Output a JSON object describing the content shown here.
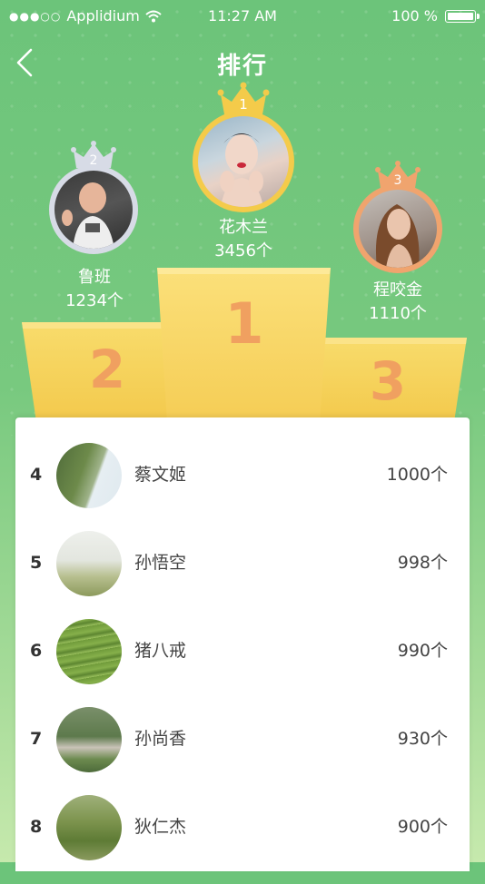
{
  "status_bar": {
    "carrier": "Applidium",
    "time": "11:27 AM",
    "battery": "100 %"
  },
  "header": {
    "title": "排行"
  },
  "podium": [
    {
      "rank": "1",
      "name": "花木兰",
      "score": "3456个"
    },
    {
      "rank": "2",
      "name": "鲁班",
      "score": "1234个"
    },
    {
      "rank": "3",
      "name": "程咬金",
      "score": "1110个"
    }
  ],
  "list": [
    {
      "rank": "4",
      "name": "蔡文姬",
      "score": "1000个"
    },
    {
      "rank": "5",
      "name": "孙悟空",
      "score": "998个"
    },
    {
      "rank": "6",
      "name": "猪八戒",
      "score": "990个"
    },
    {
      "rank": "7",
      "name": "孙尚香",
      "score": "930个"
    },
    {
      "rank": "8",
      "name": "狄仁杰",
      "score": "900个"
    }
  ],
  "colors": {
    "gold": "#f4cb4a",
    "silver": "#d7dbe6",
    "bronze": "#f0a46e",
    "podium_number": "#f0a060"
  }
}
